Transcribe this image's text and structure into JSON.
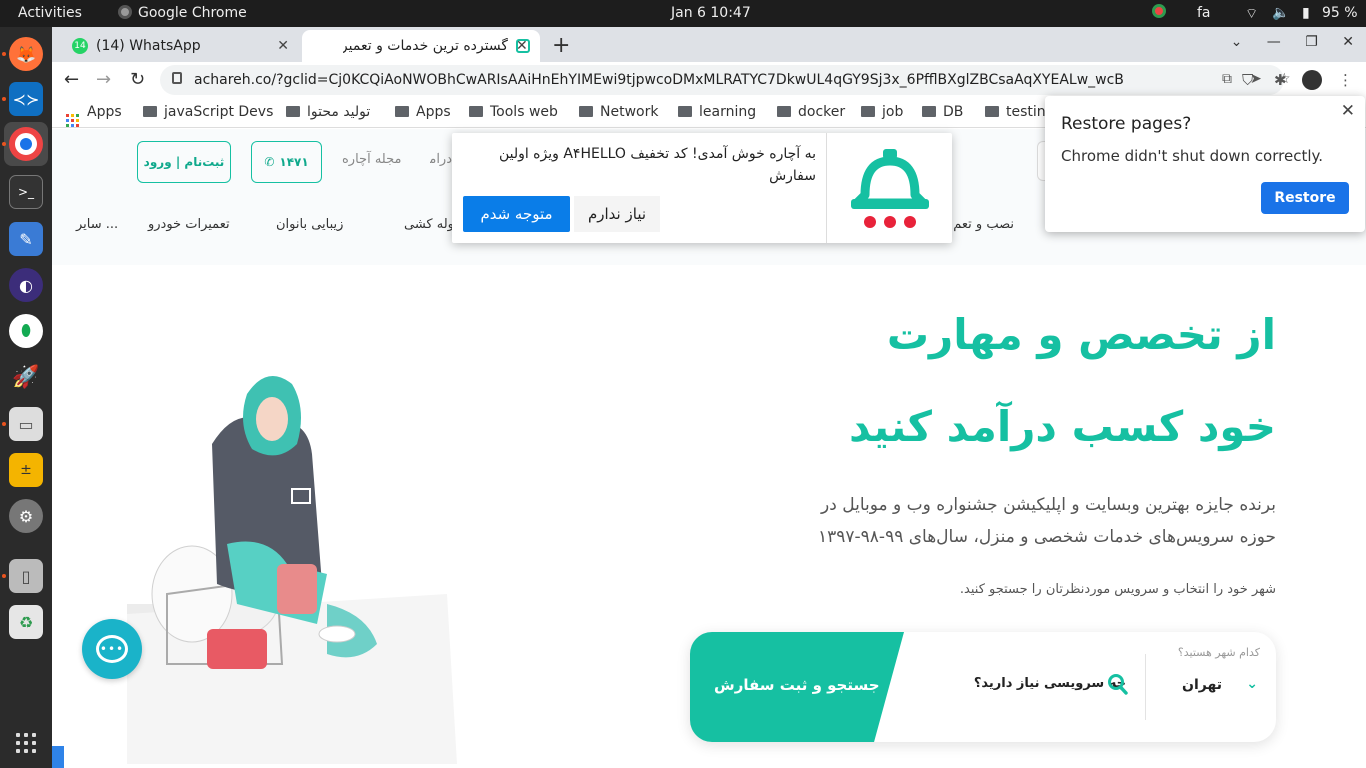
{
  "topbar": {
    "activities": "Activities",
    "app_name": "Google Chrome",
    "datetime": "Jan 6  10:47",
    "lang": "fa",
    "battery": "95 %"
  },
  "browser": {
    "tabs": [
      {
        "badge": "14",
        "title": "(14) WhatsApp"
      },
      {
        "title": "گسترده ترین خدمات و تعمیرا"
      }
    ],
    "url": "achareh.co/?gclid=Cj0KCQiAoNWOBhCwARIsAAiHnEhYIMEwi9tjpwcoDMxMLRATYC7DkwUL4qGY9Sj3x_6PfflBXglZBCsaAqXYEALw_wcB",
    "bookmarks": [
      "Apps",
      "javaScript Devs",
      "تولید محتوا",
      "Apps",
      "Tools web",
      "Network",
      "learning",
      "docker",
      "job",
      "DB",
      "testin"
    ]
  },
  "restore_bubble": {
    "title": "Restore pages?",
    "message": "Chrome didn't shut down correctly.",
    "button": "Restore"
  },
  "promo": {
    "text": "به آچاره خوش آمدی! کد تخفیف A۴HELLO ویژه اولین سفارش",
    "decline": "نیاز ندارم",
    "accept": "متوجه شدم"
  },
  "header": {
    "signup": "ثبت‌نام | ورود",
    "phone": "۱۴۷۱",
    "magazine": "مجله آچاره",
    "income_partial": "درآمد",
    "categories": [
      "سایر ...",
      "تعمیرات خودرو",
      "زیبایی بانوان",
      "لوله کشی",
      "نصب و تعم"
    ]
  },
  "hero": {
    "title_line1": "از تخصص و مهارت",
    "title_line2": "خود کسب درآمد کنید",
    "desc_line1": "برنده جایزه بهترین وبسایت و اپلیکیشن جشنواره وب و موبایل در",
    "desc_line2": "حوزه سرویس‌های خدمات شخصی و منزل، سال‌های ۹۹-۹۸-۱۳۹۷",
    "hint": "شهر خود را انتخاب و سرویس موردنظرتان را جستجو کنید."
  },
  "search": {
    "cta": "جستجو و ثبت سفارش",
    "service_question": "چه سرویسی نیاز دارید؟",
    "city_label": "کدام شهر هستید؟",
    "city_value": "تهران"
  },
  "colors": {
    "brand_teal": "#16c0a2",
    "chrome_blue": "#1a73e8",
    "promo_blue": "#0a7de8",
    "promo_red": "#e8233a"
  }
}
